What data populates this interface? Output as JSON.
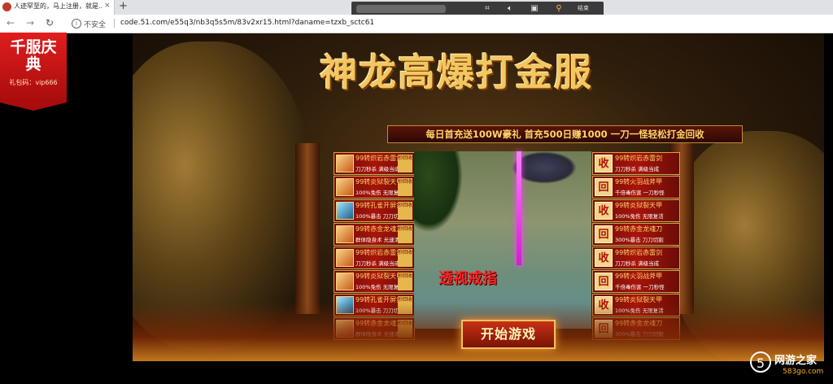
{
  "browser": {
    "tab_title": "人迹罕至的，马上注册，就是...",
    "tab_close": "×",
    "new_tab": "+",
    "media_end_label": "结束",
    "back": "←",
    "forward": "→",
    "reload": "↻",
    "security_text": "不安全",
    "url": "code.51.com/e55q3/nb3q5s5m/83v2xr15.html?daname=tzxb_sctc61"
  },
  "badge": {
    "title": "千服庆典",
    "gift_code": "礼包码：vip666"
  },
  "game": {
    "title": "神龙高爆打金服",
    "subtitle": "每日首充送100W豪礼  首充500日赚1000  一刀一怪轻松打金回收",
    "scene_caption": "透视戒指",
    "start_button": "开始游戏",
    "left_items": [
      {
        "name": "99转炽岩赤雷剑",
        "sub": "刀刀秒杀  满级当成",
        "btn": "秒回收",
        "style": "gold"
      },
      {
        "name": "99转炎狱裂天甲",
        "sub": "100%免伤  无限复活",
        "btn": "秒回收",
        "style": "gold"
      },
      {
        "name": "99转孔雀开屏剑",
        "sub": "100%暴击  刀刀切割",
        "btn": "秒回收",
        "style": "blue"
      },
      {
        "name": "99转赤金龙魂刀",
        "sub": "群体隐身术  光速清图",
        "btn": "秒回收",
        "style": "gold"
      },
      {
        "name": "99转炽岩赤雷剑",
        "sub": "刀刀秒杀  满级当成",
        "btn": "秒回收",
        "style": "gold"
      },
      {
        "name": "99转炎狱裂天甲",
        "sub": "100%免伤  无限复活",
        "btn": "秒回收",
        "style": "gold"
      },
      {
        "name": "99转孔雀开屏剑",
        "sub": "100%暴击  刀刀切割",
        "btn": "秒回收",
        "style": "blue"
      },
      {
        "name": "99转赤金龙魂刀",
        "sub": "群体隐身术  光速清图",
        "btn": "秒回收",
        "style": "gold"
      }
    ],
    "right_items": [
      {
        "btn": "收",
        "name": "99转炽岩赤雷剑",
        "sub": "刀刀秒杀  满级当成"
      },
      {
        "btn": "回",
        "name": "99转火羽战斧甲",
        "sub": "千倍毒伤害  一刀秒怪"
      },
      {
        "btn": "收",
        "name": "99转炎狱裂天甲",
        "sub": "100%免伤  无限复活"
      },
      {
        "btn": "回",
        "name": "99转赤金龙魂刀",
        "sub": "300%暴击  刀刀切割"
      },
      {
        "btn": "收",
        "name": "99转炽岩赤雷剑",
        "sub": "刀刀秒杀  满级当成"
      },
      {
        "btn": "回",
        "name": "99转火羽战斧甲",
        "sub": "千倍毒伤害  一刀秒怪"
      },
      {
        "btn": "收",
        "name": "99转炎狱裂天甲",
        "sub": "100%免伤  无限复活"
      },
      {
        "btn": "回",
        "name": "99转赤金龙魂刀",
        "sub": "300%暴击  刀刀切割"
      }
    ]
  },
  "watermark": {
    "logo": "5",
    "text": "网游之家",
    "url": "583go.com"
  }
}
